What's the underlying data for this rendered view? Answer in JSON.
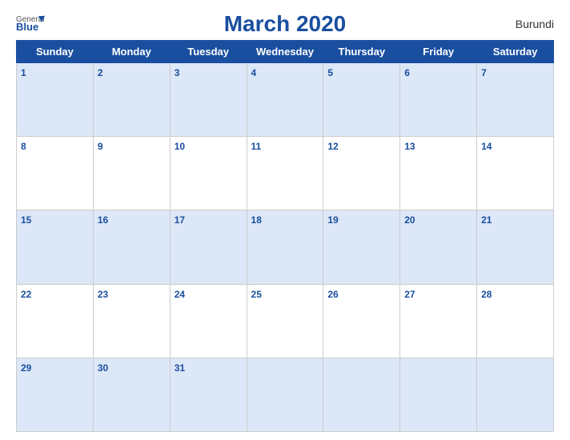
{
  "header": {
    "title": "March 2020",
    "logo_general": "General",
    "logo_blue": "Blue",
    "country": "Burundi"
  },
  "weekdays": [
    "Sunday",
    "Monday",
    "Tuesday",
    "Wednesday",
    "Thursday",
    "Friday",
    "Saturday"
  ],
  "weeks": [
    [
      {
        "day": "1",
        "empty": false
      },
      {
        "day": "2",
        "empty": false
      },
      {
        "day": "3",
        "empty": false
      },
      {
        "day": "4",
        "empty": false
      },
      {
        "day": "5",
        "empty": false
      },
      {
        "day": "6",
        "empty": false
      },
      {
        "day": "7",
        "empty": false
      }
    ],
    [
      {
        "day": "8",
        "empty": false
      },
      {
        "day": "9",
        "empty": false
      },
      {
        "day": "10",
        "empty": false
      },
      {
        "day": "11",
        "empty": false
      },
      {
        "day": "12",
        "empty": false
      },
      {
        "day": "13",
        "empty": false
      },
      {
        "day": "14",
        "empty": false
      }
    ],
    [
      {
        "day": "15",
        "empty": false
      },
      {
        "day": "16",
        "empty": false
      },
      {
        "day": "17",
        "empty": false
      },
      {
        "day": "18",
        "empty": false
      },
      {
        "day": "19",
        "empty": false
      },
      {
        "day": "20",
        "empty": false
      },
      {
        "day": "21",
        "empty": false
      }
    ],
    [
      {
        "day": "22",
        "empty": false
      },
      {
        "day": "23",
        "empty": false
      },
      {
        "day": "24",
        "empty": false
      },
      {
        "day": "25",
        "empty": false
      },
      {
        "day": "26",
        "empty": false
      },
      {
        "day": "27",
        "empty": false
      },
      {
        "day": "28",
        "empty": false
      }
    ],
    [
      {
        "day": "29",
        "empty": false
      },
      {
        "day": "30",
        "empty": false
      },
      {
        "day": "31",
        "empty": false
      },
      {
        "day": "",
        "empty": true
      },
      {
        "day": "",
        "empty": true
      },
      {
        "day": "",
        "empty": true
      },
      {
        "day": "",
        "empty": true
      }
    ]
  ]
}
